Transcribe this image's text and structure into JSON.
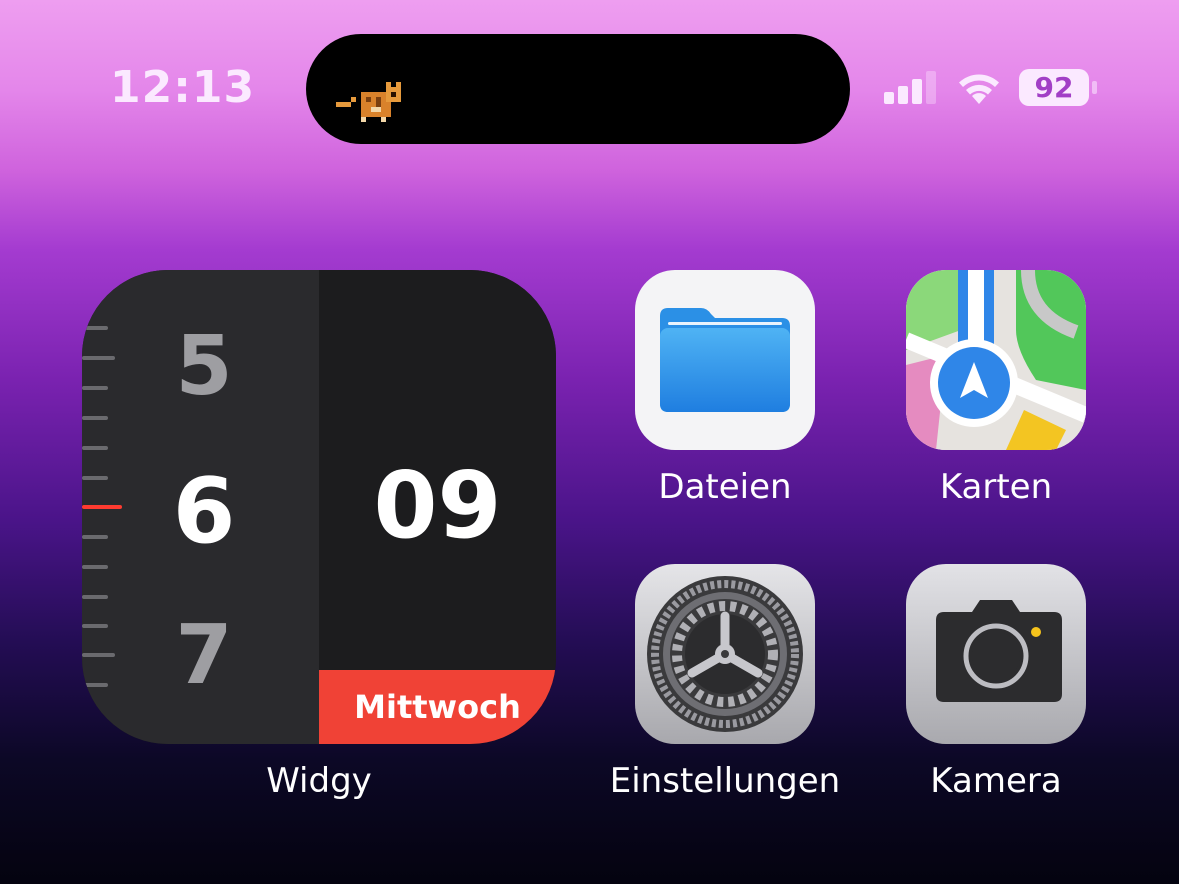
{
  "status_bar": {
    "time": "12:13",
    "battery_level": "92",
    "signal_bars_active": 3,
    "signal_bars_total": 4
  },
  "widget": {
    "app_name": "Widgy",
    "hours": [
      "5",
      "6",
      "7"
    ],
    "minutes": "09",
    "weekday": "Mittwoch",
    "accent_color": "#f04236"
  },
  "apps": [
    {
      "name": "Dateien",
      "icon": "files-folder-icon"
    },
    {
      "name": "Karten",
      "icon": "maps-icon"
    },
    {
      "name": "Einstellungen",
      "icon": "settings-gear-icon"
    },
    {
      "name": "Kamera",
      "icon": "camera-icon"
    }
  ]
}
